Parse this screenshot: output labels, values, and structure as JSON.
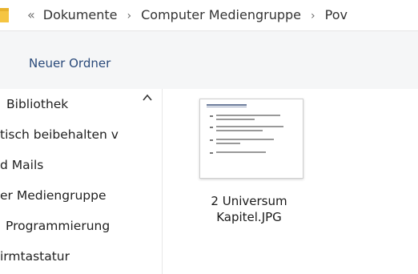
{
  "address_bar": {
    "back_glyph": "«",
    "crumbs": [
      "Dokumente",
      "Computer Mediengruppe",
      "Pov"
    ],
    "separator": "›"
  },
  "toolbar": {
    "new_folder_label": "Neuer Ordner"
  },
  "nav": {
    "items": [
      "Bibliothek",
      "tisch beibehalten v",
      "d Mails",
      "er Mediengruppe",
      "Programmierung",
      "irmtastatur"
    ]
  },
  "content": {
    "files": [
      {
        "name_line1": "2 Universum",
        "name_line2": "Kapitel.JPG",
        "icon": "image-file-thumbnail"
      }
    ]
  },
  "colors": {
    "toolbar_bg": "#f5f6f7",
    "folder_yellow": "#f5c542",
    "accent_text": "#2a4a7a"
  }
}
